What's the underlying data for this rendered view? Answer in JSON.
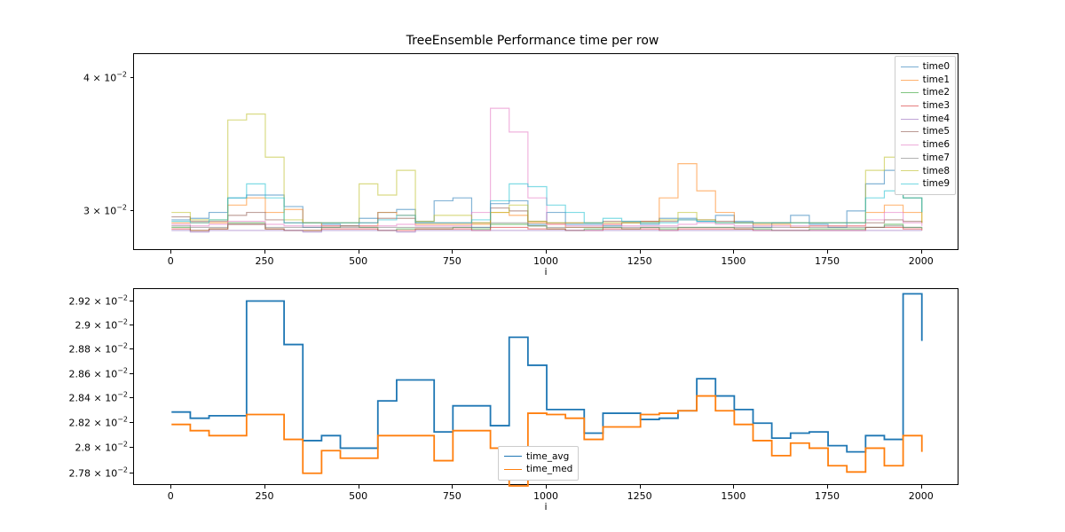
{
  "title": "TreeEnsemble Performance time per row",
  "xlabel": "i",
  "xticks": [
    "0",
    "250",
    "500",
    "750",
    "1000",
    "1250",
    "1500",
    "1750",
    "2000"
  ],
  "top_yticks": [
    "3 × 10⁻²",
    "4 × 10⁻²"
  ],
  "bottom_yticks": [
    "2.78 × 10⁻²",
    "2.8 × 10⁻²",
    "2.82 × 10⁻²",
    "2.84 × 10⁻²",
    "2.86 × 10⁻²",
    "2.88 × 10⁻²",
    "2.9 × 10⁻²",
    "2.92 × 10⁻²"
  ],
  "legend_top": [
    "time0",
    "time1",
    "time2",
    "time3",
    "time4",
    "time5",
    "time6",
    "time7",
    "time8",
    "time9"
  ],
  "legend_bottom": [
    "time_avg",
    "time_med"
  ],
  "tab10": [
    "#1f77b4",
    "#ff7f0e",
    "#2ca02c",
    "#d62728",
    "#9467bd",
    "#8c564b",
    "#e377c2",
    "#7f7f7f",
    "#bcbd22",
    "#17becf"
  ],
  "chart_data": [
    {
      "type": "line",
      "title": "TreeEnsemble Performance time per row",
      "xlabel": "i",
      "ylabel": "",
      "yscale": "log",
      "xlim": [
        -100,
        2100
      ],
      "ylim": [
        0.0265,
        0.042
      ],
      "x": [
        0,
        50,
        100,
        150,
        200,
        250,
        300,
        350,
        400,
        450,
        500,
        550,
        600,
        650,
        700,
        750,
        800,
        850,
        900,
        950,
        1000,
        1050,
        1100,
        1150,
        1200,
        1250,
        1300,
        1350,
        1400,
        1450,
        1500,
        1550,
        1600,
        1650,
        1700,
        1750,
        1800,
        1850,
        1900,
        1950,
        2000
      ],
      "series": [
        {
          "name": "time0",
          "values": [
            0.0285,
            0.0286,
            0.029,
            0.03,
            0.0302,
            0.0302,
            0.0294,
            0.028,
            0.0282,
            0.0281,
            0.0286,
            0.029,
            0.0292,
            0.0284,
            0.0298,
            0.03,
            0.028,
            0.0296,
            0.0298,
            0.0282,
            0.029,
            0.0282,
            0.0282,
            0.0281,
            0.0283,
            0.0282,
            0.0286,
            0.0286,
            0.0284,
            0.0288,
            0.0284,
            0.028,
            0.0283,
            0.0288,
            0.0282,
            0.028,
            0.0291,
            0.031,
            0.032,
            0.03,
            0.029
          ]
        },
        {
          "name": "time1",
          "values": [
            0.0283,
            0.0283,
            0.0283,
            0.0295,
            0.03,
            0.029,
            0.0292,
            0.0283,
            0.0281,
            0.0281,
            0.0281,
            0.029,
            0.0288,
            0.0282,
            0.0282,
            0.0282,
            0.0282,
            0.029,
            0.0288,
            0.0283,
            0.0282,
            0.028,
            0.028,
            0.0282,
            0.0283,
            0.0284,
            0.03,
            0.0325,
            0.0305,
            0.029,
            0.0283,
            0.0282,
            0.0282,
            0.028,
            0.0281,
            0.0281,
            0.0281,
            0.029,
            0.0295,
            0.029,
            0.0283
          ]
        },
        {
          "name": "time2",
          "values": [
            0.028,
            0.0278,
            0.0279,
            0.0283,
            0.0283,
            0.0279,
            0.0278,
            0.0278,
            0.028,
            0.0281,
            0.028,
            0.0278,
            0.0279,
            0.0279,
            0.0279,
            0.028,
            0.0279,
            0.0282,
            0.0282,
            0.0281,
            0.0279,
            0.0278,
            0.0279,
            0.028,
            0.0279,
            0.028,
            0.0279,
            0.028,
            0.028,
            0.028,
            0.0279,
            0.0279,
            0.0278,
            0.0278,
            0.0279,
            0.0279,
            0.0279,
            0.028,
            0.0282,
            0.028,
            0.0279
          ]
        },
        {
          "name": "time3",
          "values": [
            0.0279,
            0.0278,
            0.0279,
            0.0282,
            0.0282,
            0.0279,
            0.0278,
            0.0278,
            0.0279,
            0.0279,
            0.0279,
            0.0278,
            0.0278,
            0.0279,
            0.0279,
            0.0279,
            0.0278,
            0.028,
            0.028,
            0.0279,
            0.0279,
            0.0278,
            0.0278,
            0.0279,
            0.0279,
            0.0279,
            0.0278,
            0.0279,
            0.0279,
            0.0279,
            0.0279,
            0.0278,
            0.0278,
            0.0278,
            0.0278,
            0.0278,
            0.0278,
            0.028,
            0.028,
            0.0279,
            0.0278
          ]
        },
        {
          "name": "time4",
          "values": [
            0.0278,
            0.0277,
            0.0278,
            0.0278,
            0.0278,
            0.0278,
            0.0278,
            0.0277,
            0.0278,
            0.0278,
            0.0278,
            0.0278,
            0.0277,
            0.0278,
            0.0278,
            0.0278,
            0.0278,
            0.0278,
            0.0278,
            0.0278,
            0.0278,
            0.0278,
            0.0278,
            0.0278,
            0.0278,
            0.0278,
            0.0278,
            0.0278,
            0.0278,
            0.0278,
            0.0278,
            0.0278,
            0.0278,
            0.0278,
            0.0278,
            0.0278,
            0.0278,
            0.0278,
            0.0278,
            0.0278,
            0.0278
          ]
        },
        {
          "name": "time5",
          "values": [
            0.0287,
            0.0284,
            0.0284,
            0.0288,
            0.029,
            0.0285,
            0.0283,
            0.0283,
            0.0283,
            0.0283,
            0.0283,
            0.0286,
            0.0286,
            0.0283,
            0.0283,
            0.0283,
            0.0283,
            0.0293,
            0.0291,
            0.0284,
            0.0283,
            0.0283,
            0.0283,
            0.0284,
            0.0284,
            0.0284,
            0.0284,
            0.0285,
            0.0285,
            0.0284,
            0.0283,
            0.0283,
            0.0283,
            0.0283,
            0.0283,
            0.0283,
            0.0283,
            0.0283,
            0.0285,
            0.0284,
            0.0283
          ]
        },
        {
          "name": "time6",
          "values": [
            0.0282,
            0.0281,
            0.0282,
            0.0284,
            0.0284,
            0.0282,
            0.0281,
            0.0281,
            0.0281,
            0.0281,
            0.0281,
            0.0281,
            0.0282,
            0.0281,
            0.0281,
            0.0281,
            0.029,
            0.037,
            0.035,
            0.03,
            0.0282,
            0.0281,
            0.0281,
            0.0282,
            0.0281,
            0.0281,
            0.0281,
            0.0282,
            0.0283,
            0.0282,
            0.0281,
            0.0281,
            0.0281,
            0.0281,
            0.0281,
            0.0281,
            0.0281,
            0.0285,
            0.029,
            0.0283,
            0.0281
          ]
        },
        {
          "name": "time7",
          "values": [
            0.0281,
            0.028,
            0.028,
            0.0282,
            0.0282,
            0.028,
            0.028,
            0.028,
            0.028,
            0.028,
            0.028,
            0.028,
            0.028,
            0.028,
            0.028,
            0.028,
            0.028,
            0.0283,
            0.0283,
            0.0281,
            0.028,
            0.028,
            0.028,
            0.028,
            0.028,
            0.028,
            0.028,
            0.028,
            0.028,
            0.028,
            0.028,
            0.028,
            0.028,
            0.028,
            0.028,
            0.028,
            0.028,
            0.028,
            0.0281,
            0.028,
            0.028
          ]
        },
        {
          "name": "time8",
          "values": [
            0.029,
            0.0285,
            0.0285,
            0.036,
            0.0365,
            0.033,
            0.0285,
            0.0283,
            0.0283,
            0.0283,
            0.031,
            0.0302,
            0.032,
            0.0284,
            0.0288,
            0.0288,
            0.0283,
            0.029,
            0.0295,
            0.0284,
            0.0283,
            0.0283,
            0.0283,
            0.0283,
            0.0283,
            0.0283,
            0.0285,
            0.029,
            0.0285,
            0.0283,
            0.0283,
            0.0283,
            0.0283,
            0.0283,
            0.0283,
            0.0283,
            0.0283,
            0.032,
            0.033,
            0.03,
            0.0283
          ]
        },
        {
          "name": "time9",
          "values": [
            0.0284,
            0.0283,
            0.0285,
            0.03,
            0.031,
            0.03,
            0.0283,
            0.0283,
            0.0283,
            0.0283,
            0.0283,
            0.0285,
            0.0288,
            0.0283,
            0.0283,
            0.0283,
            0.0285,
            0.0298,
            0.031,
            0.0308,
            0.0295,
            0.029,
            0.0283,
            0.0286,
            0.0284,
            0.0283,
            0.0283,
            0.0285,
            0.0284,
            0.0283,
            0.0283,
            0.0283,
            0.0283,
            0.0283,
            0.0283,
            0.0283,
            0.0283,
            0.03,
            0.0305,
            0.03,
            0.029
          ]
        }
      ],
      "legend_position": "upper right"
    },
    {
      "type": "line",
      "xlabel": "i",
      "ylabel": "",
      "yscale": "log",
      "xlim": [
        -100,
        2100
      ],
      "ylim": [
        0.0277,
        0.0293
      ],
      "x": [
        0,
        50,
        100,
        150,
        200,
        250,
        300,
        350,
        400,
        450,
        500,
        550,
        600,
        650,
        700,
        750,
        800,
        850,
        900,
        950,
        1000,
        1050,
        1100,
        1150,
        1200,
        1250,
        1300,
        1350,
        1400,
        1450,
        1500,
        1550,
        1600,
        1650,
        1700,
        1750,
        1800,
        1850,
        1900,
        1950,
        2000
      ],
      "series": [
        {
          "name": "time_avg",
          "values": [
            0.02829,
            0.02824,
            0.02826,
            0.02826,
            0.0292,
            0.0292,
            0.02884,
            0.02806,
            0.0281,
            0.028,
            0.028,
            0.02838,
            0.02855,
            0.02855,
            0.02813,
            0.02834,
            0.02834,
            0.02818,
            0.0289,
            0.02867,
            0.02831,
            0.02831,
            0.02812,
            0.02828,
            0.02828,
            0.02823,
            0.02824,
            0.0283,
            0.02856,
            0.02842,
            0.02831,
            0.0282,
            0.02808,
            0.02812,
            0.02813,
            0.02802,
            0.02797,
            0.0281,
            0.02807,
            0.02926,
            0.02887,
            0.02824
          ]
        },
        {
          "name": "time_med",
          "values": [
            0.02819,
            0.02814,
            0.0281,
            0.0281,
            0.02827,
            0.02827,
            0.02807,
            0.0278,
            0.02798,
            0.02792,
            0.02792,
            0.0281,
            0.0281,
            0.0281,
            0.0279,
            0.02814,
            0.02814,
            0.028,
            0.0277,
            0.02828,
            0.02827,
            0.02824,
            0.02807,
            0.02817,
            0.02817,
            0.02827,
            0.02828,
            0.0283,
            0.02842,
            0.0283,
            0.02819,
            0.02806,
            0.02794,
            0.02804,
            0.028,
            0.02786,
            0.02781,
            0.028,
            0.02786,
            0.0281,
            0.02797,
            0.02817
          ]
        }
      ],
      "legend_position": "lower center"
    }
  ]
}
